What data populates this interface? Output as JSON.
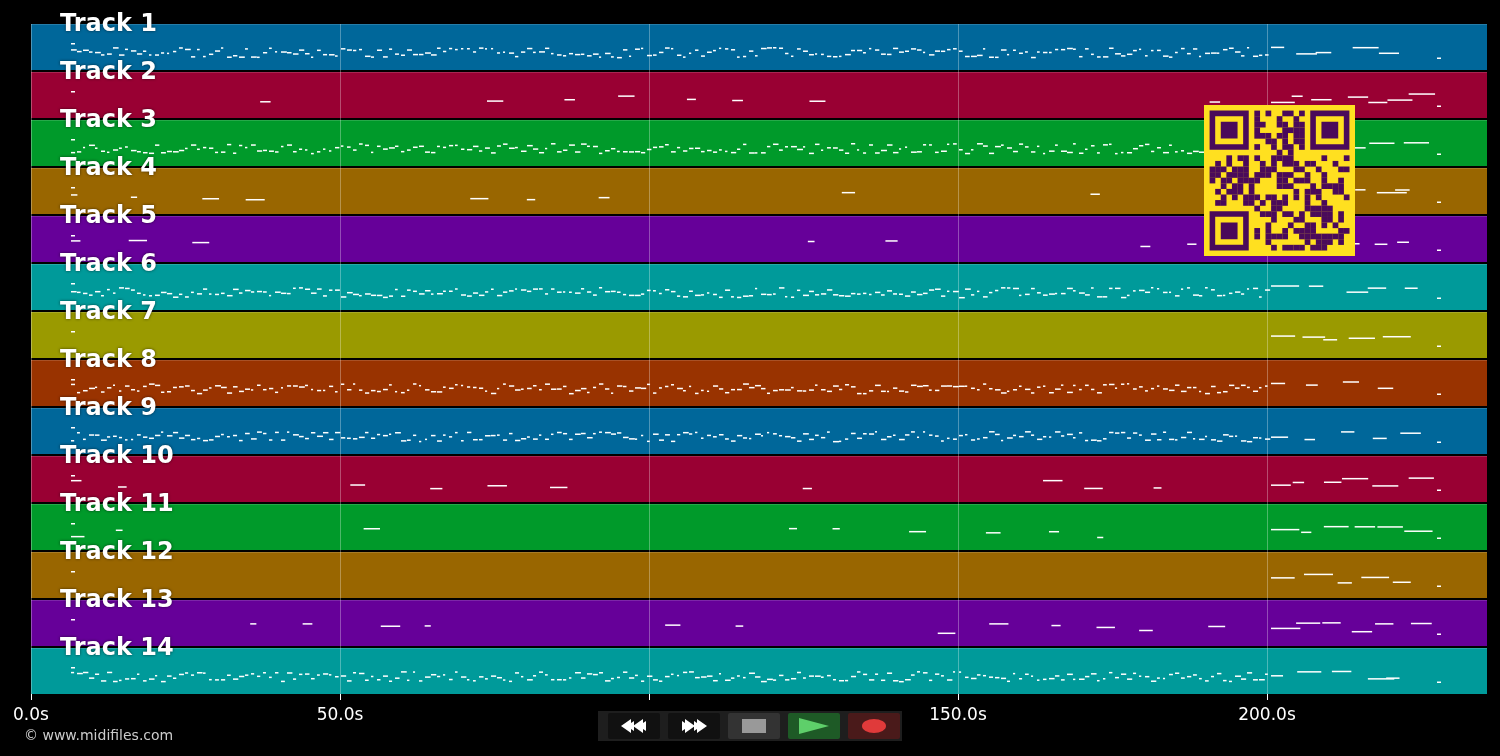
{
  "tracks": [
    {
      "name": "Track 1",
      "color": "#00679a"
    },
    {
      "name": "Track 2",
      "color": "#990033"
    },
    {
      "name": "Track 3",
      "color": "#009a2a"
    },
    {
      "name": "Track 4",
      "color": "#996600"
    },
    {
      "name": "Track 5",
      "color": "#660099"
    },
    {
      "name": "Track 6",
      "color": "#009a9a"
    },
    {
      "name": "Track 7",
      "color": "#9a9a00"
    },
    {
      "name": "Track 8",
      "color": "#993300"
    },
    {
      "name": "Track 9",
      "color": "#00679a"
    },
    {
      "name": "Track 10",
      "color": "#990033"
    },
    {
      "name": "Track 11",
      "color": "#009a2a"
    },
    {
      "name": "Track 12",
      "color": "#996600"
    },
    {
      "name": "Track 13",
      "color": "#660099"
    },
    {
      "name": "Track 14",
      "color": "#009a9a"
    }
  ],
  "time_axis": [
    "0.0s",
    "50.0s",
    "150.0s",
    "200.0s"
  ],
  "transport": [
    {
      "kind": "rewind"
    },
    {
      "kind": "forward"
    },
    {
      "kind": "stop"
    },
    {
      "kind": "play"
    },
    {
      "kind": "record"
    }
  ],
  "copyright": "© www.midifiles.com"
}
